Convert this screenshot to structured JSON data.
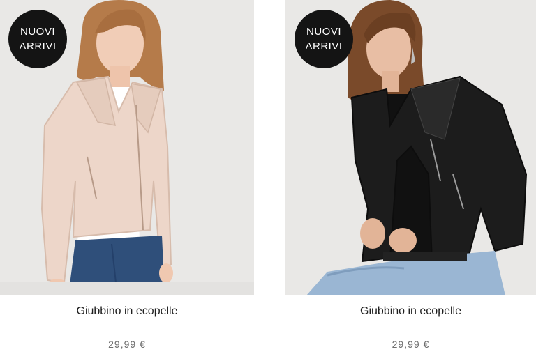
{
  "products": [
    {
      "badge": {
        "line1": "NUOVI",
        "line2": "ARRIVI"
      },
      "name": "Giubbino in ecopelle",
      "price": "29,99 €",
      "jacket_color": "#ecd5c8",
      "image_alt": "Giubbino in ecopelle"
    },
    {
      "badge": {
        "line1": "NUOVI",
        "line2": "ARRIVI"
      },
      "name": "Giubbino in ecopelle",
      "price": "29,99 €",
      "jacket_color": "#1c1c1c",
      "image_alt": "Giubbino in ecopelle"
    }
  ],
  "colors": {
    "badge_bg": "#141414",
    "image_bg": "#e8e7e6",
    "price_text": "#6e6e6e",
    "name_text": "#1e1e1e"
  }
}
